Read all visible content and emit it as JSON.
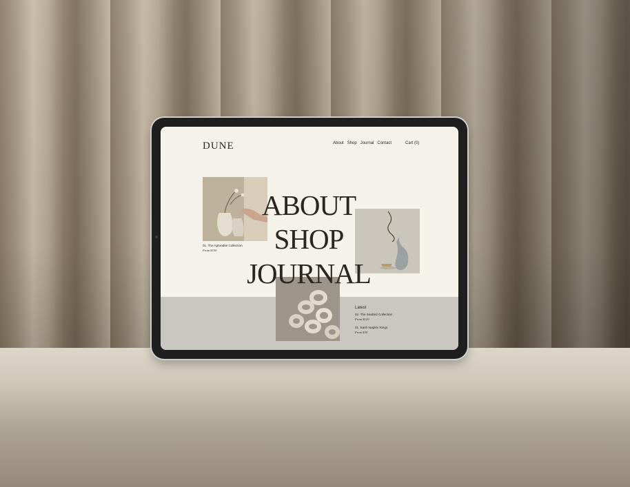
{
  "site": {
    "logo": "DUNE",
    "nav": [
      "About",
      "Shop",
      "Journal",
      "Contact"
    ],
    "cart": "Cart (0)"
  },
  "hero": {
    "line1": "ABOUT",
    "line2": "SHOP",
    "line3": "JOURNAL"
  },
  "featured": {
    "title": "01. The Aphrodite Collection",
    "price": "From $150"
  },
  "latest": {
    "heading": "Latest",
    "items": [
      {
        "title": "02. The Seabird Collection",
        "price": "From $120"
      },
      {
        "title": "01. Earth Napkin Rings",
        "price": "From $30"
      }
    ]
  },
  "colors": {
    "screen_bg": "#f5f2ea",
    "band_bg": "#c9c7bf",
    "text": "#2a2722"
  }
}
